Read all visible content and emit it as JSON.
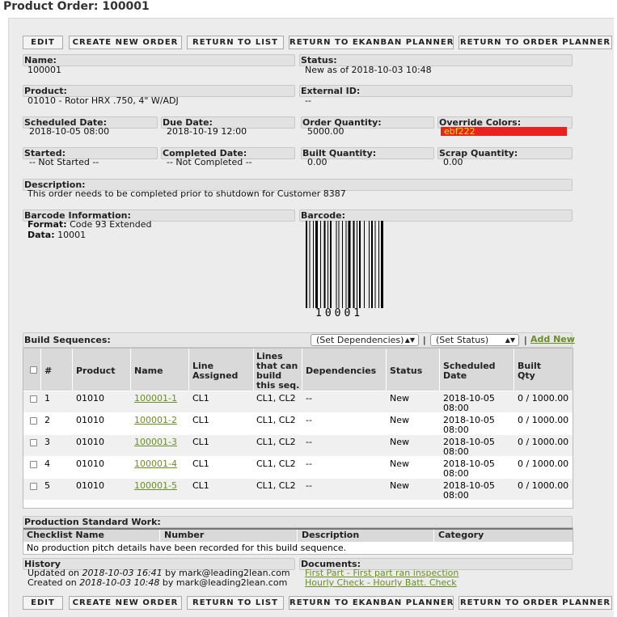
{
  "page_title": "Product Order: 100001",
  "toolbar": {
    "edit": "EDIT",
    "create_new_order": "CREATE NEW ORDER",
    "return_to_list": "RETURN TO LIST",
    "return_to_ekanban": "RETURN TO EKANBAN PLANNER",
    "return_to_order_planner": "RETURN TO ORDER PLANNER"
  },
  "fields": {
    "name_label": "Name:",
    "name_value": "100001",
    "status_label": "Status:",
    "status_value": "New as of 2018-10-03 10:48",
    "product_label": "Product:",
    "product_value": "01010 - Rotor HRX .750, 4\" W/ADJ",
    "external_id_label": "External ID:",
    "external_id_value": "--",
    "scheduled_date_label": "Scheduled Date:",
    "scheduled_date_value": "2018-10-05 08:00",
    "due_date_label": "Due Date:",
    "due_date_value": "2018-10-19 12:00",
    "order_qty_label": "Order Quantity:",
    "order_qty_value": "5000.00",
    "override_colors_label": "Override Colors:",
    "override_colors_value": "ebf222",
    "started_label": "Started:",
    "started_value": "-- Not Started --",
    "completed_label": "Completed Date:",
    "completed_value": "-- Not Completed --",
    "built_qty_label": "Built Quantity:",
    "built_qty_value": "0.00",
    "scrap_qty_label": "Scrap Quantity:",
    "scrap_qty_value": "0.00",
    "description_label": "Description:",
    "description_value": "This order needs to be completed prior to shutdown for Customer 8387",
    "barcode_info_label": "Barcode Information:",
    "format_key": "Format:",
    "format_value": "Code 93 Extended",
    "data_key": "Data:",
    "data_value": "10001",
    "barcode_label": "Barcode:",
    "barcode_text": "10001"
  },
  "colors": {
    "override_bg": "#e8231f",
    "override_text": "#ebf222",
    "link": "#6b8e23"
  },
  "build_sequences": {
    "label": "Build Sequences:",
    "set_dependencies": "(Set Dependencies)",
    "set_status": "(Set Status)",
    "sep1": "|",
    "sep2": "|",
    "add_new": "Add New",
    "columns": {
      "num": "#",
      "product": "Product",
      "name": "Name",
      "line_assigned": "Line Assigned",
      "lines_can_build": "Lines that can build this seq.",
      "dependencies": "Dependencies",
      "status": "Status",
      "scheduled_date": "Scheduled Date",
      "built_qty": "Built Qty"
    },
    "rows": [
      {
        "num": "1",
        "product": "01010",
        "name": "100001-1",
        "line": "CL1",
        "lines": "CL1, CL2",
        "deps": "--",
        "status": "New",
        "date": "2018-10-05",
        "time": "08:00",
        "built": "0 / 1000.00"
      },
      {
        "num": "2",
        "product": "01010",
        "name": "100001-2",
        "line": "CL1",
        "lines": "CL1, CL2",
        "deps": "--",
        "status": "New",
        "date": "2018-10-05",
        "time": "08:00",
        "built": "0 / 1000.00"
      },
      {
        "num": "3",
        "product": "01010",
        "name": "100001-3",
        "line": "CL1",
        "lines": "CL1, CL2",
        "deps": "--",
        "status": "New",
        "date": "2018-10-05",
        "time": "08:00",
        "built": "0 / 1000.00"
      },
      {
        "num": "4",
        "product": "01010",
        "name": "100001-4",
        "line": "CL1",
        "lines": "CL1, CL2",
        "deps": "--",
        "status": "New",
        "date": "2018-10-05",
        "time": "08:00",
        "built": "0 / 1000.00"
      },
      {
        "num": "5",
        "product": "01010",
        "name": "100001-5",
        "line": "CL1",
        "lines": "CL1, CL2",
        "deps": "--",
        "status": "New",
        "date": "2018-10-05",
        "time": "08:00",
        "built": "0 / 1000.00"
      }
    ]
  },
  "standard_work": {
    "label": "Production Standard Work:",
    "columns": {
      "checklist": "Checklist Name",
      "number": "Number",
      "description": "Description",
      "category": "Category"
    },
    "empty": "No production pitch details have been recorded for this build sequence."
  },
  "history": {
    "label": "History",
    "updated_prefix": "Updated on",
    "updated_date": "2018-10-03 16:41",
    "updated_by": "by mark@leading2lean.com",
    "created_prefix": "Created on",
    "created_date": "2018-10-03 10:48",
    "created_by": "by mark@leading2lean.com"
  },
  "documents": {
    "label": "Documents:",
    "items": [
      "First Part - First part ran inspection",
      "Hourly Check - Hourly Batt. Check"
    ]
  }
}
